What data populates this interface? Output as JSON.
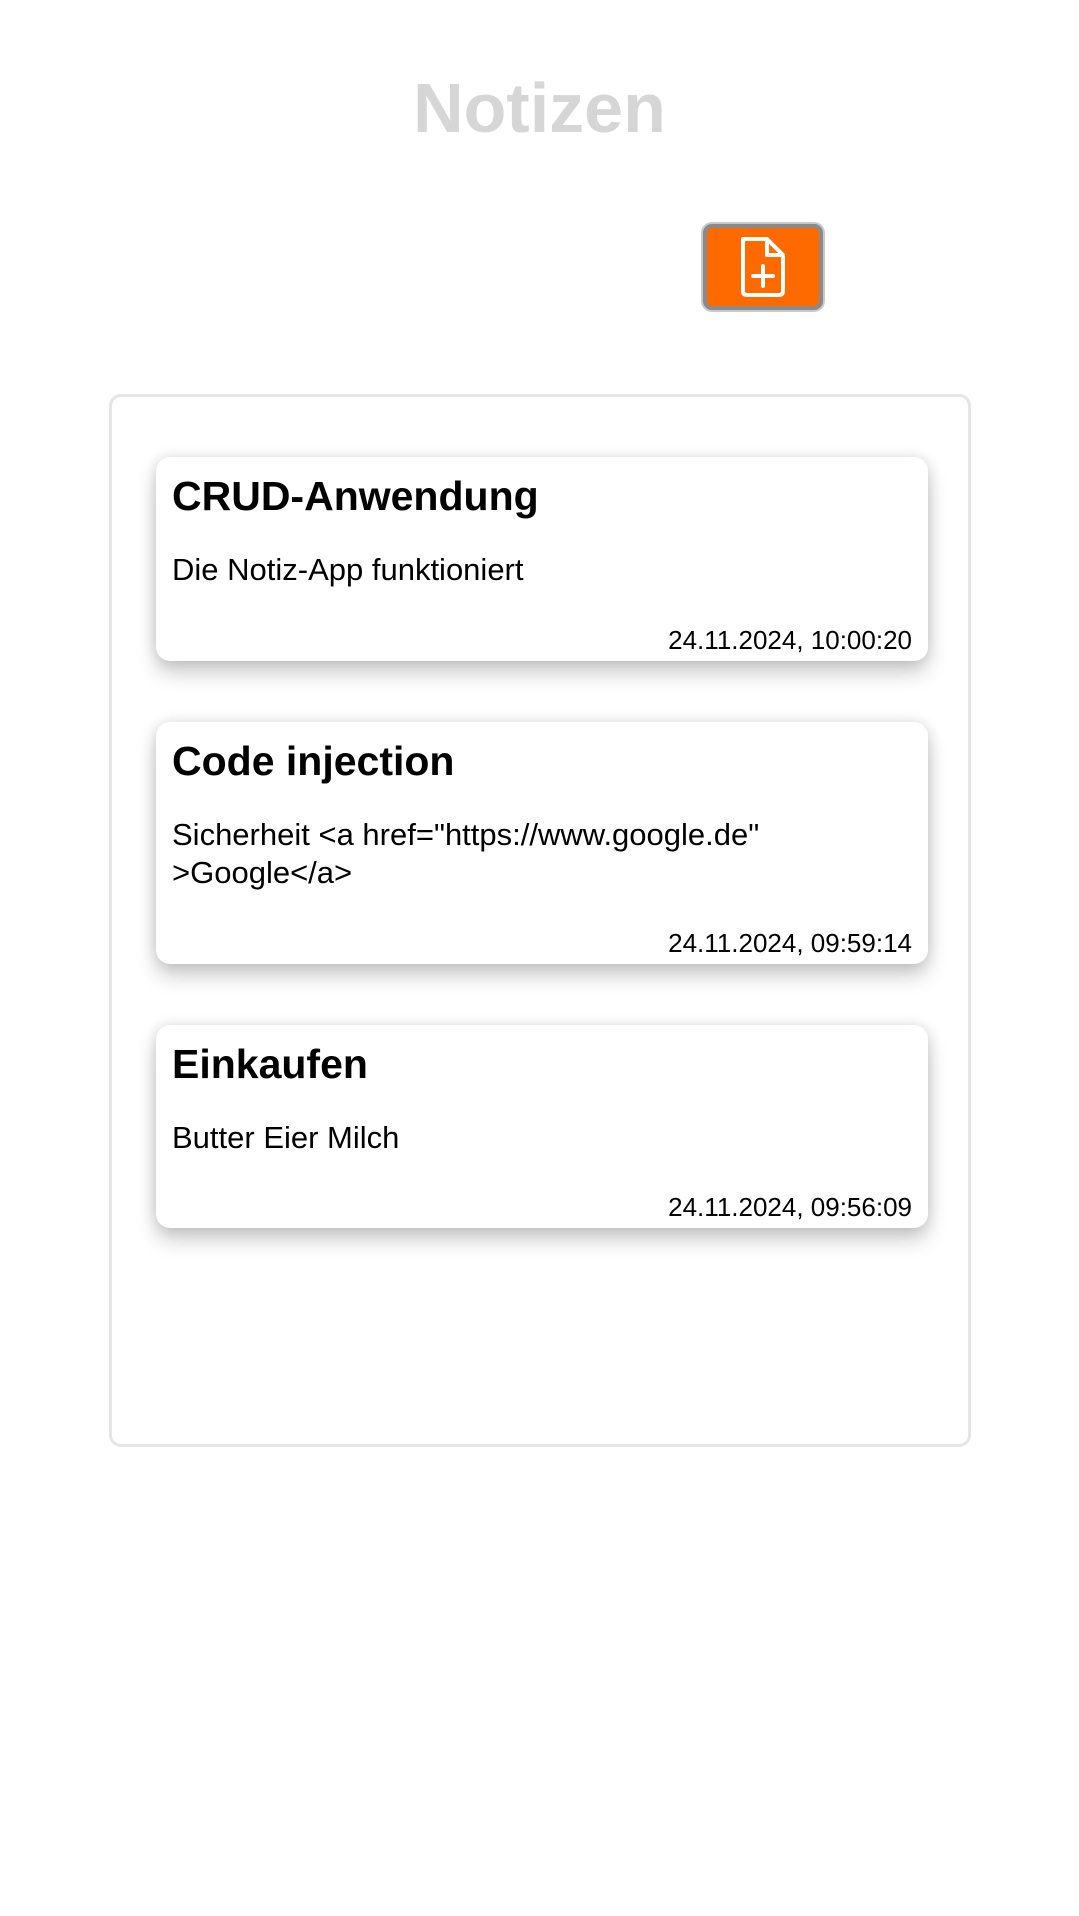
{
  "header": {
    "title": "Notizen"
  },
  "toolbar": {
    "add_icon": "file-plus-icon",
    "accent_color": "#ff6a00"
  },
  "notes": [
    {
      "title": "CRUD-Anwendung",
      "body": "Die Notiz-App funktioniert",
      "date": "24.11.2024, 10:00:20"
    },
    {
      "title": "Code injection",
      "body": "Sicherheit <a href=\"https://www.google.de\" >Google</a>",
      "date": "24.11.2024, 09:59:14"
    },
    {
      "title": "Einkaufen",
      "body": "Butter Eier Milch",
      "date": "24.11.2024, 09:56:09"
    }
  ]
}
